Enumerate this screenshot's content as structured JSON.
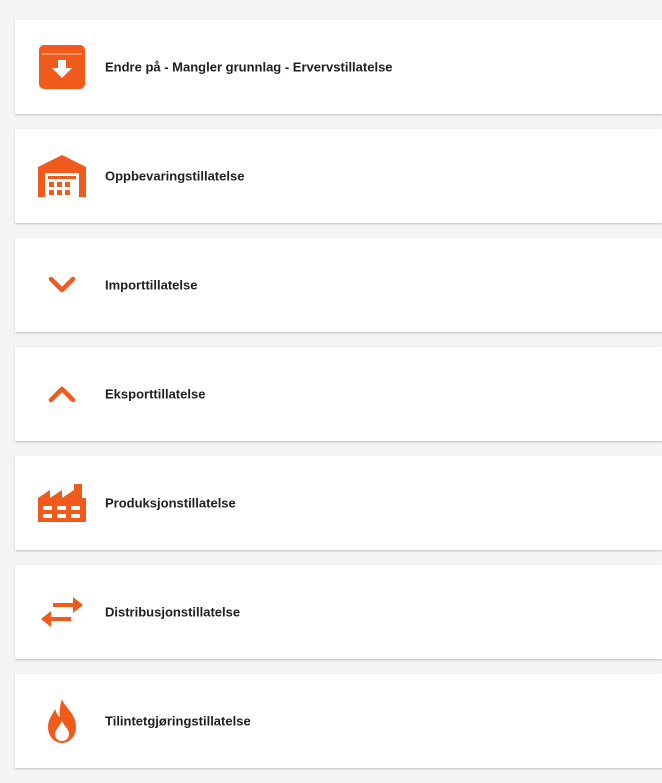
{
  "accent_color": "#f05a1a",
  "items": [
    {
      "label": "Endre på - Mangler grunnlag - Ervervstillatelse",
      "icon": "download-box-icon"
    },
    {
      "label": "Oppbevaringstillatelse",
      "icon": "warehouse-icon"
    },
    {
      "label": "Importtillatelse",
      "icon": "chevron-down-icon"
    },
    {
      "label": "Eksporttillatelse",
      "icon": "chevron-up-icon"
    },
    {
      "label": "Produksjonstillatelse",
      "icon": "factory-icon"
    },
    {
      "label": "Distribusjonstillatelse",
      "icon": "swap-arrows-icon"
    },
    {
      "label": "Tilintetgjøringstillatelse",
      "icon": "fire-icon"
    }
  ]
}
